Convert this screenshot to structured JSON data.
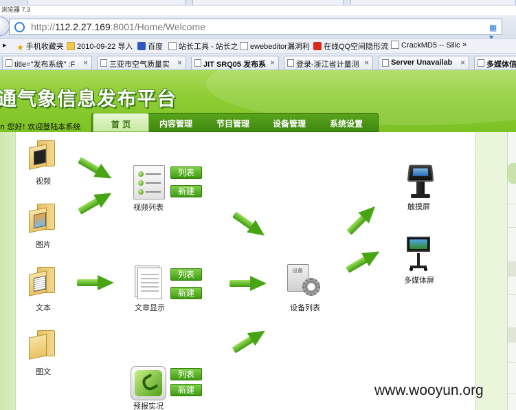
{
  "browser": {
    "edition_label": "浏览器 7.3",
    "url_scheme": "http://",
    "url_host": "112.2.27.169",
    "url_rest": ":8001/Home/Welcome",
    "favorites": [
      {
        "label": "手机收藏夹",
        "icon": "star-icon"
      },
      {
        "label": "2010-09-22 导入",
        "icon": "folder-icon"
      },
      {
        "label": "百度",
        "icon": "baidu-paw-icon"
      },
      {
        "label": "站长工具 - 站长之",
        "icon": "page-icon"
      },
      {
        "label": "ewebeditor漏洞利",
        "icon": "page-icon"
      },
      {
        "label": "在线QQ空间隐形流",
        "icon": "app-icon"
      },
      {
        "label": "CrackMD5 -- Silic",
        "icon": "page-icon"
      }
    ],
    "more_chevron": "»",
    "tabs": [
      {
        "label": "title=\"发布系统\" :F",
        "bold": false
      },
      {
        "label": "三亚市空气质量实",
        "bold": false
      },
      {
        "label": "JIT SRQ05 发布系",
        "bold": true
      },
      {
        "label": "登录-浙江省计量测",
        "bold": false
      },
      {
        "label": "Server Unavailab",
        "bold": true
      },
      {
        "label": "多媒体信",
        "bold": true
      }
    ],
    "tab_close": "×"
  },
  "header": {
    "site_title": "通气象信息发布平台",
    "welcome": "n 您好! 欢迎登陆本系统",
    "nav": [
      "首 页",
      "内容管理",
      "节目管理",
      "设备管理",
      "系统设置"
    ],
    "active_nav_index": 0
  },
  "flow": {
    "sources": [
      {
        "label": "视频",
        "icon": "video-folder-icon"
      },
      {
        "label": "图片",
        "icon": "picture-folder-icon"
      },
      {
        "label": "文本",
        "icon": "text-folder-icon"
      },
      {
        "label": "图文",
        "icon": "image-text-folder-icon"
      }
    ],
    "modules": [
      {
        "label": "视频列表",
        "icon": "list-icon",
        "buttons": [
          "列表",
          "新建"
        ]
      },
      {
        "label": "文章显示",
        "icon": "document-icon",
        "buttons": [
          "列表",
          "新建"
        ]
      },
      {
        "label": "预报实况",
        "icon": "phone-icon",
        "buttons": [
          "列表",
          "新建"
        ]
      }
    ],
    "hub": {
      "label": "设备列表",
      "icon_tag": "设备"
    },
    "targets": [
      {
        "label": "触摸屏",
        "icon": "touch-kiosk-icon"
      },
      {
        "label": "多媒体屏",
        "icon": "multimedia-screen-icon"
      }
    ]
  },
  "watermark": "www.wooyun.org"
}
